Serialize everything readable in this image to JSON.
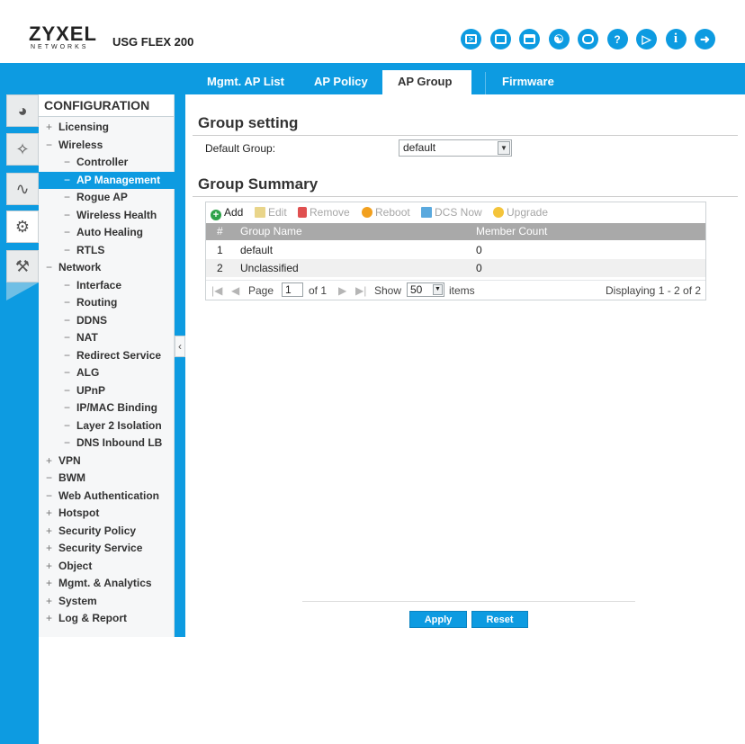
{
  "header": {
    "brand": "ZYXEL",
    "brand_sub": "NETWORKS",
    "model": "USG FLEX 200",
    "icons": [
      "console-icon",
      "cli-icon",
      "window-icon",
      "network-icon",
      "chat-icon",
      "help-icon",
      "broadcast-icon",
      "info-icon",
      "logout-icon"
    ]
  },
  "rail": {
    "items": [
      "dashboard-icon",
      "wizard-icon",
      "monitor-icon",
      "configuration-icon",
      "maintenance-icon"
    ],
    "active": "configuration-icon"
  },
  "nav": {
    "title": "CONFIGURATION",
    "items": [
      {
        "sym": "+",
        "label": "Licensing",
        "level": 1
      },
      {
        "sym": "−",
        "label": "Wireless",
        "level": 1
      },
      {
        "sym": "−",
        "label": "Controller",
        "level": 2
      },
      {
        "sym": "−",
        "label": "AP Management",
        "level": 2,
        "selected": true
      },
      {
        "sym": "−",
        "label": "Rogue AP",
        "level": 2
      },
      {
        "sym": "−",
        "label": "Wireless Health",
        "level": 2
      },
      {
        "sym": "−",
        "label": "Auto Healing",
        "level": 2
      },
      {
        "sym": "−",
        "label": "RTLS",
        "level": 2
      },
      {
        "sym": "−",
        "label": "Network",
        "level": 1
      },
      {
        "sym": "−",
        "label": "Interface",
        "level": 2
      },
      {
        "sym": "−",
        "label": "Routing",
        "level": 2
      },
      {
        "sym": "−",
        "label": "DDNS",
        "level": 2
      },
      {
        "sym": "−",
        "label": "NAT",
        "level": 2
      },
      {
        "sym": "−",
        "label": "Redirect Service",
        "level": 2
      },
      {
        "sym": "−",
        "label": "ALG",
        "level": 2
      },
      {
        "sym": "−",
        "label": "UPnP",
        "level": 2
      },
      {
        "sym": "−",
        "label": "IP/MAC Binding",
        "level": 2
      },
      {
        "sym": "−",
        "label": "Layer 2 Isolation",
        "level": 2
      },
      {
        "sym": "−",
        "label": "DNS Inbound LB",
        "level": 2
      },
      {
        "sym": "+",
        "label": "VPN",
        "level": 1
      },
      {
        "sym": "−",
        "label": "BWM",
        "level": 1
      },
      {
        "sym": "−",
        "label": "Web Authentication",
        "level": 1
      },
      {
        "sym": "+",
        "label": "Hotspot",
        "level": 1
      },
      {
        "sym": "+",
        "label": "Security Policy",
        "level": 1
      },
      {
        "sym": "+",
        "label": "Security Service",
        "level": 1
      },
      {
        "sym": "+",
        "label": "Object",
        "level": 1
      },
      {
        "sym": "+",
        "label": "Mgmt. & Analytics",
        "level": 1
      },
      {
        "sym": "+",
        "label": "System",
        "level": 1
      },
      {
        "sym": "+",
        "label": "Log & Report",
        "level": 1
      }
    ]
  },
  "tabs": [
    {
      "label": "Mgmt. AP List"
    },
    {
      "label": "AP Policy"
    },
    {
      "label": "AP Group",
      "active": true
    },
    {
      "label": "Firmware"
    }
  ],
  "group_setting": {
    "title": "Group setting",
    "default_label": "Default Group:",
    "default_value": "default"
  },
  "group_summary": {
    "title": "Group Summary",
    "toolbar": {
      "add": "Add",
      "edit": "Edit",
      "remove": "Remove",
      "reboot": "Reboot",
      "dcs_now": "DCS Now",
      "upgrade": "Upgrade"
    },
    "columns": {
      "num": "#",
      "name": "Group Name",
      "count": "Member Count"
    },
    "rows": [
      {
        "num": "1",
        "name": "default",
        "count": "0"
      },
      {
        "num": "2",
        "name": "Unclassified",
        "count": "0"
      }
    ],
    "pager": {
      "page_label": "Page",
      "page_value": "1",
      "of_label": "of 1",
      "show_label": "Show",
      "show_value": "50",
      "items_label": "items",
      "display_text": "Displaying 1 - 2 of 2"
    }
  },
  "buttons": {
    "apply": "Apply",
    "reset": "Reset"
  },
  "colors": {
    "accent": "#0d9be1",
    "grid_header": "#a9a9a9",
    "add_green": "#2ea24a",
    "remove_red": "#e05050",
    "reboot_orange": "#f2a01e"
  }
}
